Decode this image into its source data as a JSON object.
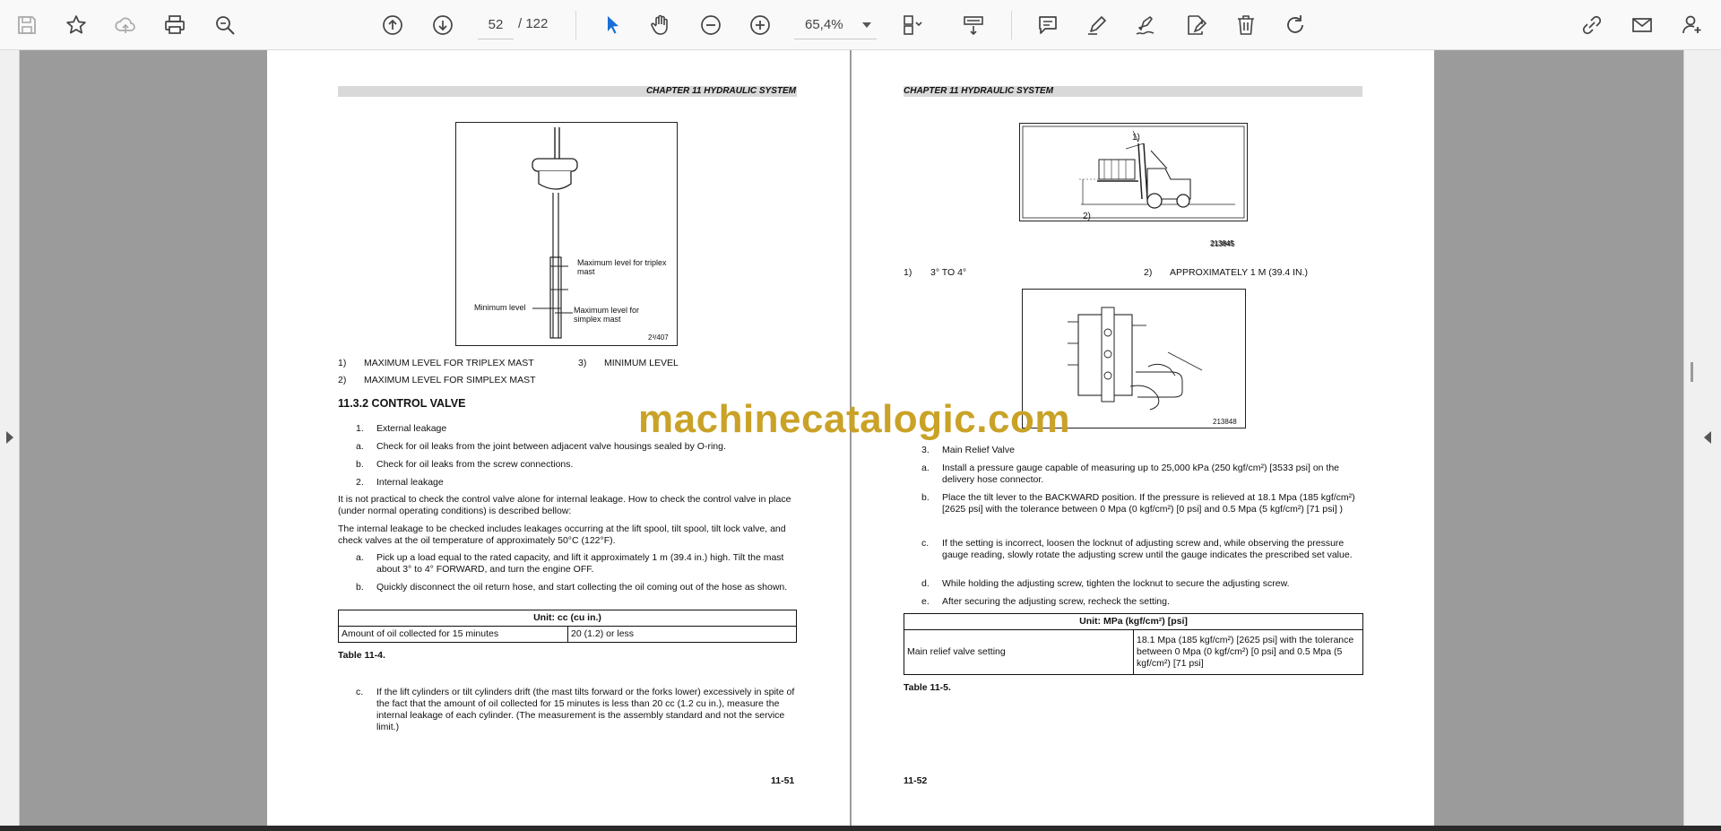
{
  "toolbar": {
    "page_current": "52",
    "page_total": "/  122",
    "zoom": "65,4%",
    "icons": [
      "save-icon",
      "bookmark-star-icon",
      "cloud-upload-icon",
      "print-icon",
      "zoom-search-icon",
      "page-up-icon",
      "page-down-icon",
      "select-cursor-icon",
      "hand-pan-icon",
      "zoom-out-icon",
      "zoom-in-icon",
      "page-organize-icon",
      "scan-icon",
      "comment-icon",
      "highlight-pen-icon",
      "sign-pen-icon",
      "edit-doc-icon",
      "delete-icon",
      "redo-icon",
      "share-link-icon",
      "mail-icon",
      "user-add-icon"
    ]
  },
  "watermark": "machinecatalogic.com",
  "left_page": {
    "chapter_header": "CHAPTER 11 HYDRAULIC SYSTEM",
    "figure": {
      "label_max_triplex": "Maximum level for triplex mast",
      "label_min": "Minimum level",
      "label_max_simplex": "Maximum level for simplex mast",
      "fig_id": "2³/407"
    },
    "legend": {
      "item1_num": "1)",
      "item1": "MAXIMUM LEVEL FOR TRIPLEX MAST",
      "item3_num": "3)",
      "item3": "MINIMUM LEVEL",
      "item2_num": "2)",
      "item2": "MAXIMUM LEVEL FOR SIMPLEX MAST"
    },
    "section_title": "11.3.2   CONTROL VALVE",
    "list": [
      {
        "m": "1.",
        "t": "External leakage"
      },
      {
        "m": "a.",
        "t": "Check for oil leaks from the joint between adjacent valve housings sealed by O-ring."
      },
      {
        "m": "b.",
        "t": "Check for oil leaks from the screw connections."
      },
      {
        "m": "2.",
        "t": "Internal leakage"
      }
    ],
    "para1": "It is not practical to check the control valve alone for internal leakage. How to check the control valve in place (under normal operating conditions) is described bellow:",
    "para2": "The internal leakage to be checked includes leakages occurring at the lift spool, tilt spool, tilt lock valve, and check valves at the oil temperature of approximately 50°C (122°F).",
    "steps": [
      {
        "m": "a.",
        "t": "Pick up a load equal to the rated capacity, and lift it approximately 1 m (39.4 in.) high. Tilt the mast about 3° to 4° FORWARD, and turn the engine OFF."
      },
      {
        "m": "b.",
        "t": "Quickly disconnect the oil return hose, and start collecting the oil coming out of the hose as shown."
      }
    ],
    "table": {
      "header": "Unit: cc (cu in.)",
      "row_label": "Amount of oil collected for 15 minutes",
      "row_value": "20 (1.2) or less",
      "caption": "Table 11-4."
    },
    "step_c_m": "c.",
    "step_c": "If the lift cylinders or tilt cylinders drift (the mast tilts forward or the forks lower) excessively in spite of the fact that the amount of oil collected for 15 minutes is less than 20 cc (1.2 cu in.), measure the internal leakage of each cylinder. (The measurement is the assembly standard and not the service limit.)",
    "page_number": "11-51"
  },
  "right_page": {
    "chapter_header": "CHAPTER 11 HYDRAULIC SYSTEM",
    "figure1": {
      "callout1": "1)",
      "callout2": "2)",
      "fig_id": "213845"
    },
    "legend": {
      "item1_num": "1)",
      "item1": "3° TO 4°",
      "item2_num": "2)",
      "item2": "APPROXIMATELY 1 M (39.4 IN.)"
    },
    "figure2": {
      "fig_id": "213848"
    },
    "step3_m": "3.",
    "step3": "Main Relief Valve",
    "steps": [
      {
        "m": "a.",
        "t": "Install a pressure gauge capable of measuring up to 25,000 kPa (250 kgf/cm²) [3533 psi] on the delivery hose connector."
      },
      {
        "m": "b.",
        "t": "Place the tilt lever to the BACKWARD position. If the pressure is relieved at 18.1 Mpa (185 kgf/cm²) [2625 psi] with the tolerance between 0 Mpa (0 kgf/cm²) [0 psi] and 0.5 Mpa (5 kgf/cm²) [71 psi] )"
      },
      {
        "m": "c.",
        "t": "If the setting is incorrect, loosen the locknut of adjusting screw and, while observing the pressure gauge reading, slowly rotate the adjusting screw until the gauge indicates the prescribed set value."
      },
      {
        "m": "d.",
        "t": "While holding the adjusting screw, tighten the locknut to secure the adjusting screw."
      },
      {
        "m": "e.",
        "t": "After securing the adjusting screw, recheck the setting."
      }
    ],
    "table": {
      "header": "Unit: MPa (kgf/cm²) [psi]",
      "row_label": "Main relief valve setting",
      "row_value": "18.1 Mpa (185 kgf/cm²) [2625 psi] with the tolerance between 0 Mpa (0 kgf/cm²) [0 psi] and 0.5 Mpa (5 kgf/cm²) [71 psi]",
      "caption": "Table 11-5."
    },
    "page_number": "11-52"
  }
}
